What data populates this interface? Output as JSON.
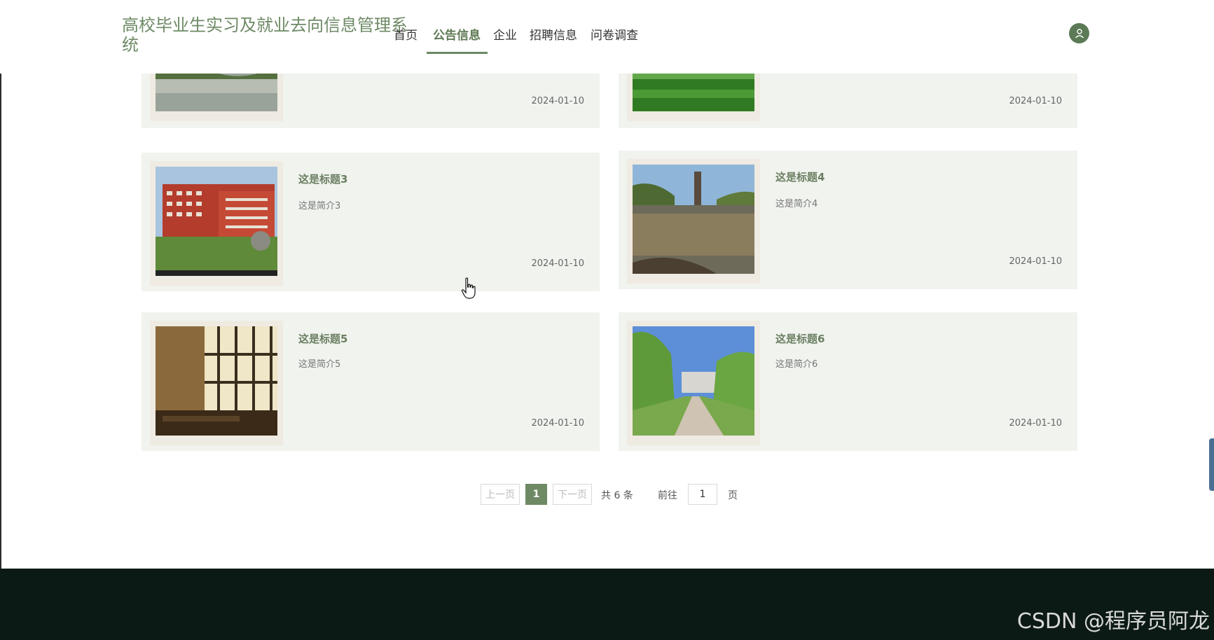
{
  "header": {
    "site_title": "高校毕业生实习及就业去向信息管理系统",
    "nav": [
      "首页",
      "公告信息",
      "企业",
      "招聘信息",
      "问卷调查"
    ],
    "active_nav": "公告信息"
  },
  "cards": [
    {
      "title": "",
      "desc": "",
      "date": "2024-01-10",
      "image": "campus-river-photo"
    },
    {
      "title": "",
      "desc": "",
      "date": "2024-01-10",
      "image": "green-lawn-photo"
    },
    {
      "title": "这是标题3",
      "desc": "这是简介3",
      "date": "2024-01-10",
      "image": "red-building-photo"
    },
    {
      "title": "这是标题4",
      "desc": "这是简介4",
      "date": "2024-01-10",
      "image": "lake-tower-photo"
    },
    {
      "title": "这是标题5",
      "desc": "这是简介5",
      "date": "2024-01-10",
      "image": "sunlit-classroom-photo"
    },
    {
      "title": "这是标题6",
      "desc": "这是简介6",
      "date": "2024-01-10",
      "image": "tree-lined-path-photo"
    }
  ],
  "pagination": {
    "prev": "上一页",
    "current": "1",
    "next": "下一页",
    "total": "共 6 条",
    "goto": "前往",
    "goto_value": "1",
    "page_unit": "页"
  },
  "watermark": "CSDN @程序员阿龙",
  "colors": {
    "accent": "#6e8a65",
    "card_bg": "#f0f3ee",
    "footer_bg": "#0c1a15"
  }
}
